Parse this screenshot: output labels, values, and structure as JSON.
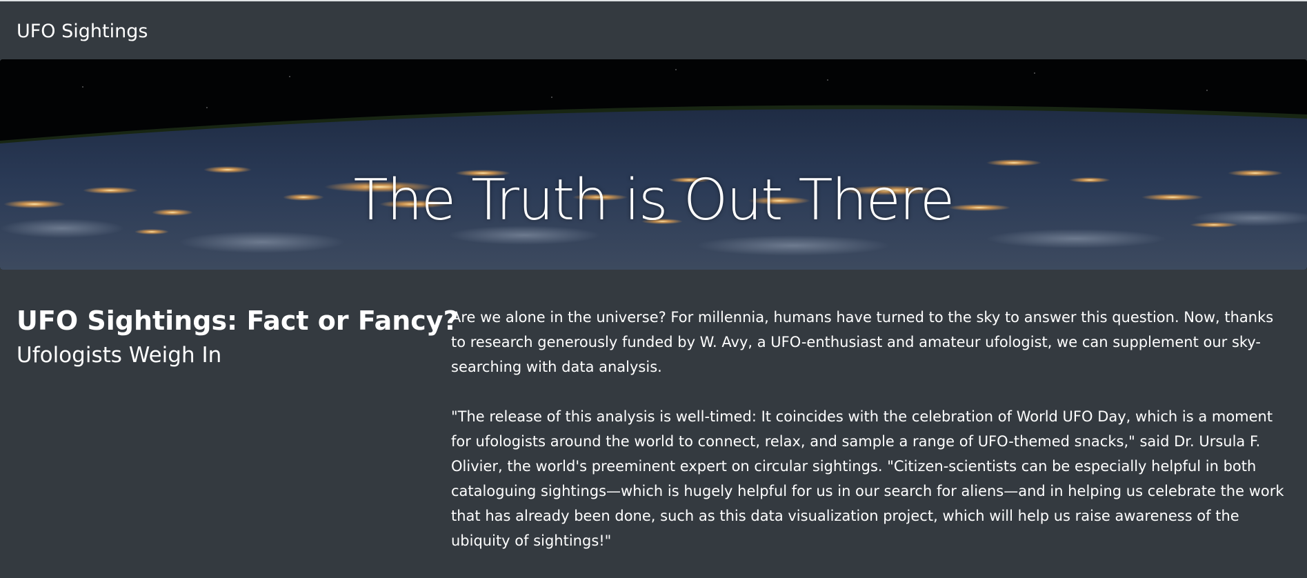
{
  "navbar": {
    "brand": "UFO Sightings"
  },
  "hero": {
    "title": "The Truth is Out There"
  },
  "article": {
    "title": "UFO Sightings: Fact or Fancy?",
    "subtitle": "Ufologists Weigh In",
    "paragraphs": [
      "Are we alone in the universe? For millennia, humans have turned to the sky to answer this question. Now, thanks to research generously funded by W. Avy, a UFO-enthusiast and amateur ufologist, we can supplement our sky-searching with data analysis.",
      "\"The release of this analysis is well-timed: It coincides with the celebration of World UFO Day, which is a moment for ufologists around the world to connect, relax, and sample a range of UFO-themed snacks,\" said Dr. Ursula F. Olivier, the world's preeminent expert on circular sightings. \"Citizen-scientists can be especially helpful in both cataloguing sightings—which is hugely helpful for us in our search for aliens—and in helping us celebrate the work that has already been done, such as this data visualization project, which will help us raise awareness of the ubiquity of sightings!\""
    ]
  },
  "colors": {
    "page_background": "#343a40",
    "text": "#ffffff"
  }
}
